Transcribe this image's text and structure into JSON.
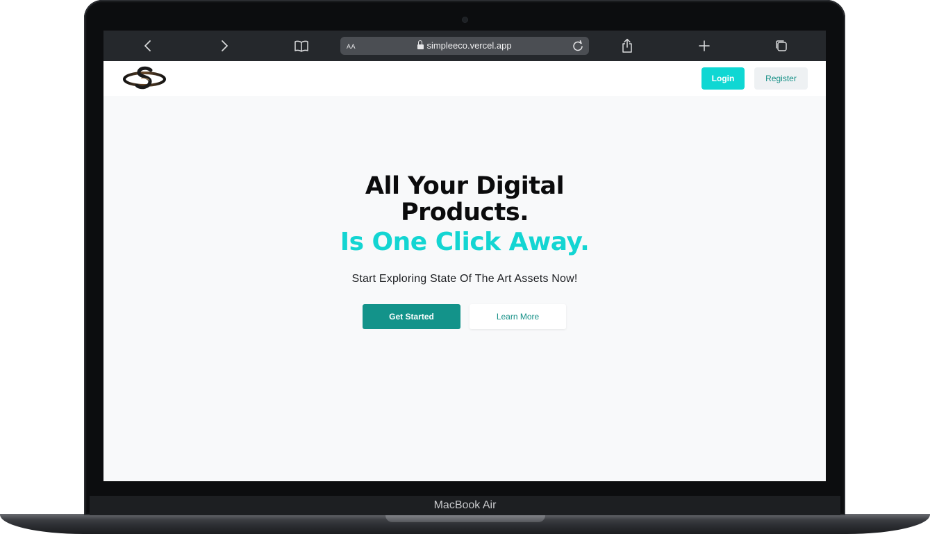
{
  "device": {
    "model_label": "MacBook Air"
  },
  "browser": {
    "address": {
      "text_size_label": "AA",
      "url": "simpleeco.vercel.app"
    },
    "icons": {
      "back": "chevron-left-icon",
      "forward": "chevron-right-icon",
      "bookmarks": "book-icon",
      "lock": "lock-icon",
      "reload": "reload-icon",
      "share": "share-icon",
      "new_tab": "plus-icon",
      "tabs": "tabs-icon"
    },
    "colors": {
      "toolbar": "#25282c",
      "address_bar": "#4b4e53"
    }
  },
  "site": {
    "nav": {
      "logo": "site-logo",
      "login_label": "Login",
      "register_label": "Register"
    },
    "hero": {
      "title_line1": "All Your Digital",
      "title_line2": "Products.",
      "title_line3": "Is One Click Away.",
      "subtitle": "Start Exploring State Of The Art Assets Now!",
      "primary_cta": "Get Started",
      "secondary_cta": "Learn More"
    },
    "colors": {
      "accent_cyan": "#13d5d2",
      "login_button": "#0fd7d3",
      "primary_button": "#13938a",
      "background": "#f8f9fa"
    }
  }
}
